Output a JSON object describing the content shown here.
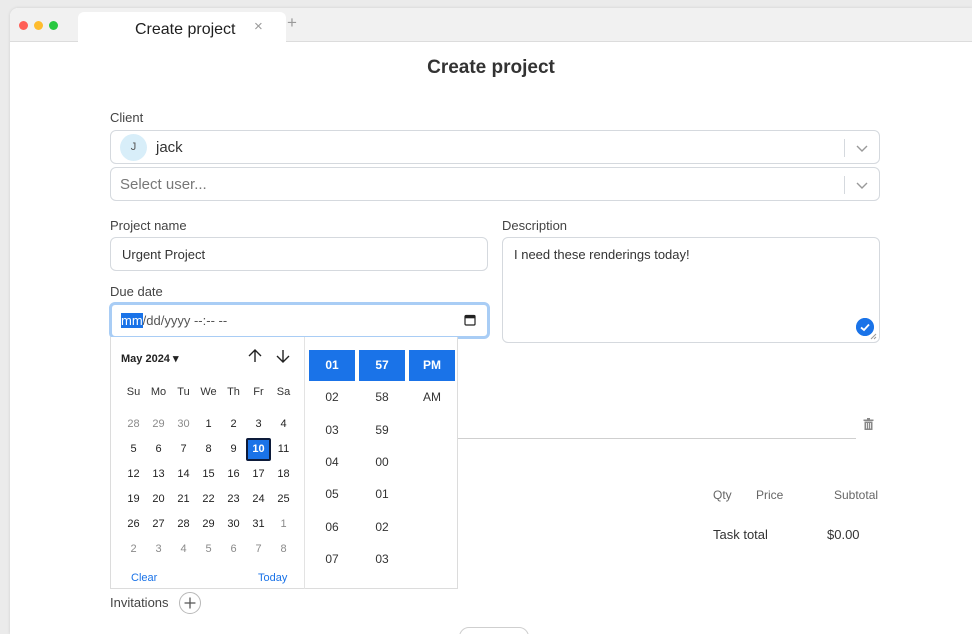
{
  "browser": {
    "tab_title": "Create project",
    "tab_close": "×",
    "new_tab": "+"
  },
  "page": {
    "title": "Create project"
  },
  "client": {
    "label": "Client",
    "selected": {
      "initial": "J",
      "name": "jack"
    },
    "user_placeholder": "Select user..."
  },
  "project_name": {
    "label": "Project name",
    "value": "Urgent Project"
  },
  "description": {
    "label": "Description",
    "value": "I need these renderings today!"
  },
  "due_date": {
    "label": "Due date",
    "segment_highlight": "mm",
    "segment_rest": "/dd/yyyy --:-- --"
  },
  "calendar": {
    "month_label": "May 2024",
    "caret": "▾",
    "weekdays": [
      "Su",
      "Mo",
      "Tu",
      "We",
      "Th",
      "Fr",
      "Sa"
    ],
    "weeks": [
      [
        "28",
        "29",
        "30",
        "1",
        "2",
        "3",
        "4"
      ],
      [
        "5",
        "6",
        "7",
        "8",
        "9",
        "10",
        "11"
      ],
      [
        "12",
        "13",
        "14",
        "15",
        "16",
        "17",
        "18"
      ],
      [
        "19",
        "20",
        "21",
        "22",
        "23",
        "24",
        "25"
      ],
      [
        "26",
        "27",
        "28",
        "29",
        "30",
        "31",
        "1"
      ],
      [
        "2",
        "3",
        "4",
        "5",
        "6",
        "7",
        "8"
      ]
    ],
    "selected_day": "10",
    "clear_label": "Clear",
    "today_label": "Today"
  },
  "time_picker": {
    "hours": [
      "01",
      "02",
      "03",
      "04",
      "05",
      "06",
      "07"
    ],
    "minutes": [
      "57",
      "58",
      "59",
      "00",
      "01",
      "02",
      "03"
    ],
    "periods": [
      "PM",
      "AM"
    ]
  },
  "tasks": {
    "qty_header": "Qty",
    "price_header": "Price",
    "subtotal_header": "Subtotal",
    "total_label": "Task total",
    "total_value": "$0.00"
  },
  "invitations": {
    "label": "Invitations"
  },
  "colors": {
    "accent": "#1a73e8",
    "focus_ring": "#a9cdf5",
    "avatar_bg": "#d8eef9"
  }
}
